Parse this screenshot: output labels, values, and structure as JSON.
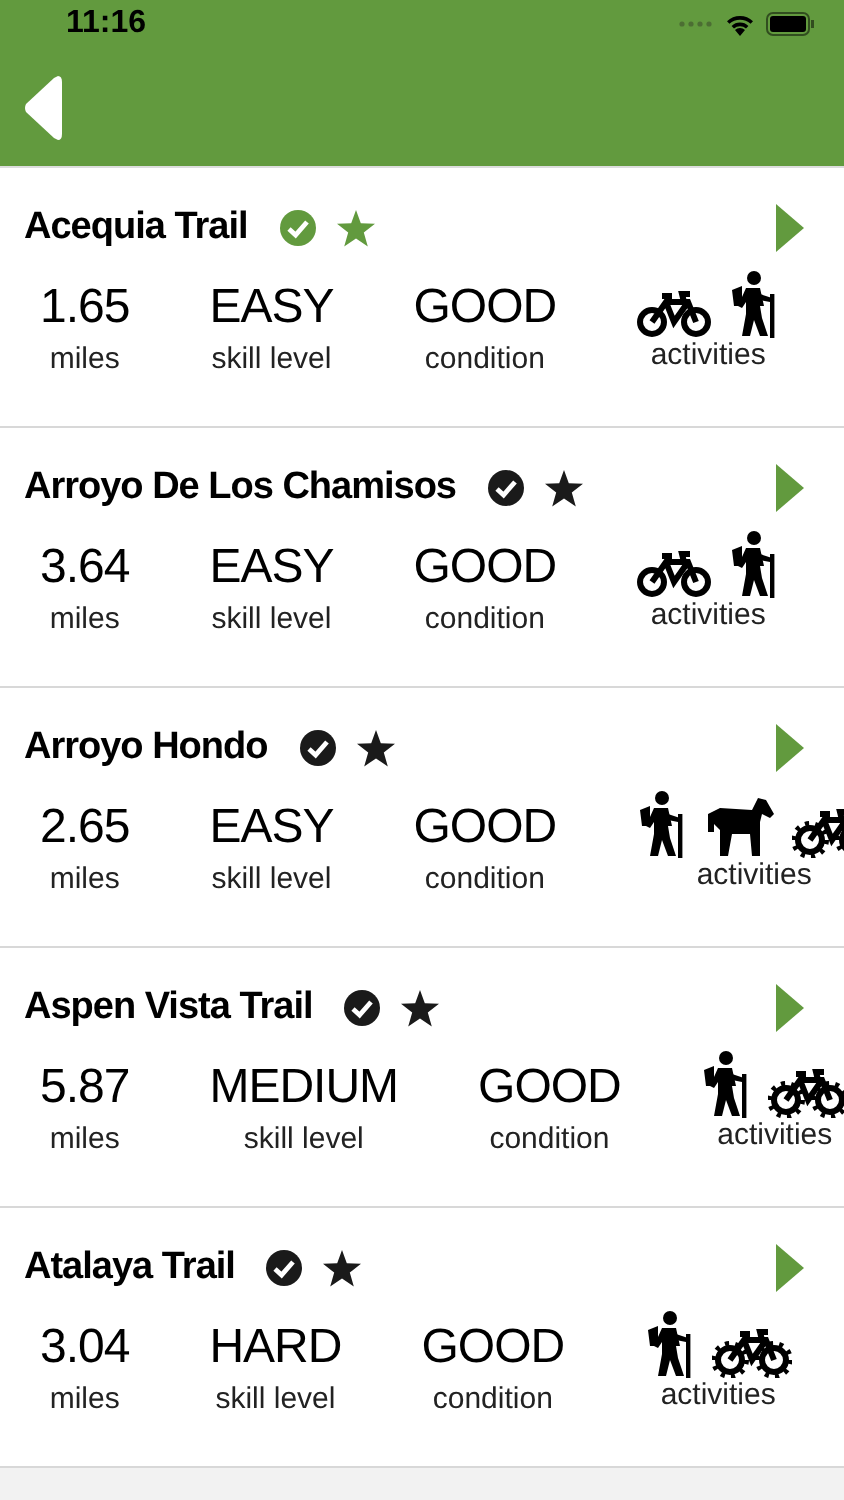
{
  "status_bar": {
    "time": "11:16"
  },
  "trails": [
    {
      "name": "Acequia Trail",
      "completed": true,
      "favorite": true,
      "miles": "1.65",
      "miles_label": "miles",
      "skill": "EASY",
      "skill_label": "skill level",
      "condition": "GOOD",
      "condition_label": "condition",
      "activities": [
        {
          "kind": "bike"
        },
        {
          "kind": "hike"
        }
      ],
      "activities_label": "activities"
    },
    {
      "name": "Arroyo De Los Chamisos",
      "completed": false,
      "favorite": false,
      "miles": "3.64",
      "miles_label": "miles",
      "skill": "EASY",
      "skill_label": "skill level",
      "condition": "GOOD",
      "condition_label": "condition",
      "activities": [
        {
          "kind": "bike"
        },
        {
          "kind": "hike"
        }
      ],
      "activities_label": "activities"
    },
    {
      "name": "Arroyo Hondo",
      "completed": false,
      "favorite": false,
      "miles": "2.65",
      "miles_label": "miles",
      "skill": "EASY",
      "skill_label": "skill level",
      "condition": "GOOD",
      "condition_label": "condition",
      "activities": [
        {
          "kind": "hike"
        },
        {
          "kind": "horse"
        },
        {
          "kind": "mountain-bike"
        }
      ],
      "activities_label": "activities"
    },
    {
      "name": "Aspen Vista Trail",
      "completed": false,
      "favorite": false,
      "miles": "5.87",
      "miles_label": "miles",
      "skill": "MEDIUM",
      "skill_label": "skill level",
      "condition": "GOOD",
      "condition_label": "condition",
      "activities": [
        {
          "kind": "hike"
        },
        {
          "kind": "mountain-bike"
        }
      ],
      "activities_label": "activities"
    },
    {
      "name": "Atalaya Trail",
      "completed": false,
      "favorite": false,
      "miles": "3.04",
      "miles_label": "miles",
      "skill": "HARD",
      "skill_label": "skill level",
      "condition": "GOOD",
      "condition_label": "condition",
      "activities": [
        {
          "kind": "hike"
        },
        {
          "kind": "mountain-bike"
        }
      ],
      "activities_label": "activities"
    }
  ]
}
